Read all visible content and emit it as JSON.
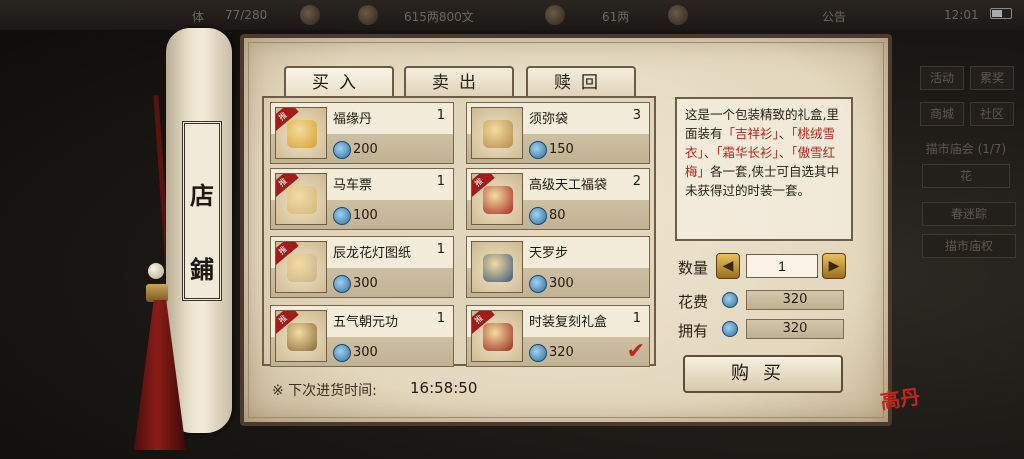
{
  "status_bar": {
    "stamina": "77/280",
    "money": "615两800文",
    "silver": "61两",
    "notice": "公告",
    "time": "12:01"
  },
  "side_menu": {
    "items": [
      "活动",
      "累奖",
      "商城",
      "社区"
    ],
    "market_label": "描市庙会 (1/7)",
    "sub_label": "花",
    "quick_buttons": [
      "春迷踪",
      "描市庙权"
    ]
  },
  "shop": {
    "title_chars": [
      "店",
      "鋪"
    ],
    "tabs": [
      {
        "label": "买入",
        "active": true
      },
      {
        "label": "卖出",
        "active": false
      },
      {
        "label": "赎回",
        "active": false
      }
    ],
    "items": [
      {
        "name": "福缘丹",
        "qty": "1",
        "price": "200",
        "badge": "推",
        "icon": "fortune-pill-bag-icon",
        "color": "#d9a12c"
      },
      {
        "name": "须弥袋",
        "qty": "3",
        "price": "150",
        "badge": "",
        "icon": "sumeru-pouch-icon",
        "color": "#b78a4c"
      },
      {
        "name": "马车票",
        "qty": "1",
        "price": "100",
        "badge": "推",
        "icon": "carriage-ticket-icon",
        "color": "#d2b77b"
      },
      {
        "name": "高级天工福袋",
        "qty": "2",
        "price": "80",
        "badge": "推",
        "icon": "lucky-bag-icon",
        "color": "#a72a22"
      },
      {
        "name": "辰龙花灯图纸",
        "qty": "1",
        "price": "300",
        "badge": "推",
        "icon": "lantern-blueprint-icon",
        "color": "#c7b28a"
      },
      {
        "name": "天罗步",
        "qty": "",
        "price": "300",
        "badge": "",
        "icon": "skill-book-icon",
        "color": "#3d5a80"
      },
      {
        "name": "五气朝元功",
        "qty": "1",
        "price": "300",
        "badge": "推",
        "icon": "martial-manual-icon",
        "color": "#8a6a3a"
      },
      {
        "name": "时装复刻礼盒",
        "qty": "1",
        "price": "320",
        "badge": "推",
        "icon": "gift-box-icon",
        "color": "#9a2a20",
        "selected": true
      }
    ],
    "restock_label": "※ 下次进货时间:",
    "restock_time": "16:58:50",
    "description": {
      "p1": "这是一个包装精致的礼盒,里面装有",
      "n1": "「吉祥衫」",
      "s1": "、",
      "n2": "「桃绒雪衣」",
      "s2": "、",
      "n3": "「霜华长衫」",
      "s3": "、",
      "n4": "「傲雪红梅」",
      "p2": "各一套,侠士可自选其中未获得过的时装一套。"
    },
    "quantity_label": "数量",
    "quantity": "1",
    "cost_label": "花费",
    "cost": "320",
    "own_label": "拥有",
    "owned": "320",
    "buy_label": "购买",
    "stamp_text": "高丹"
  }
}
